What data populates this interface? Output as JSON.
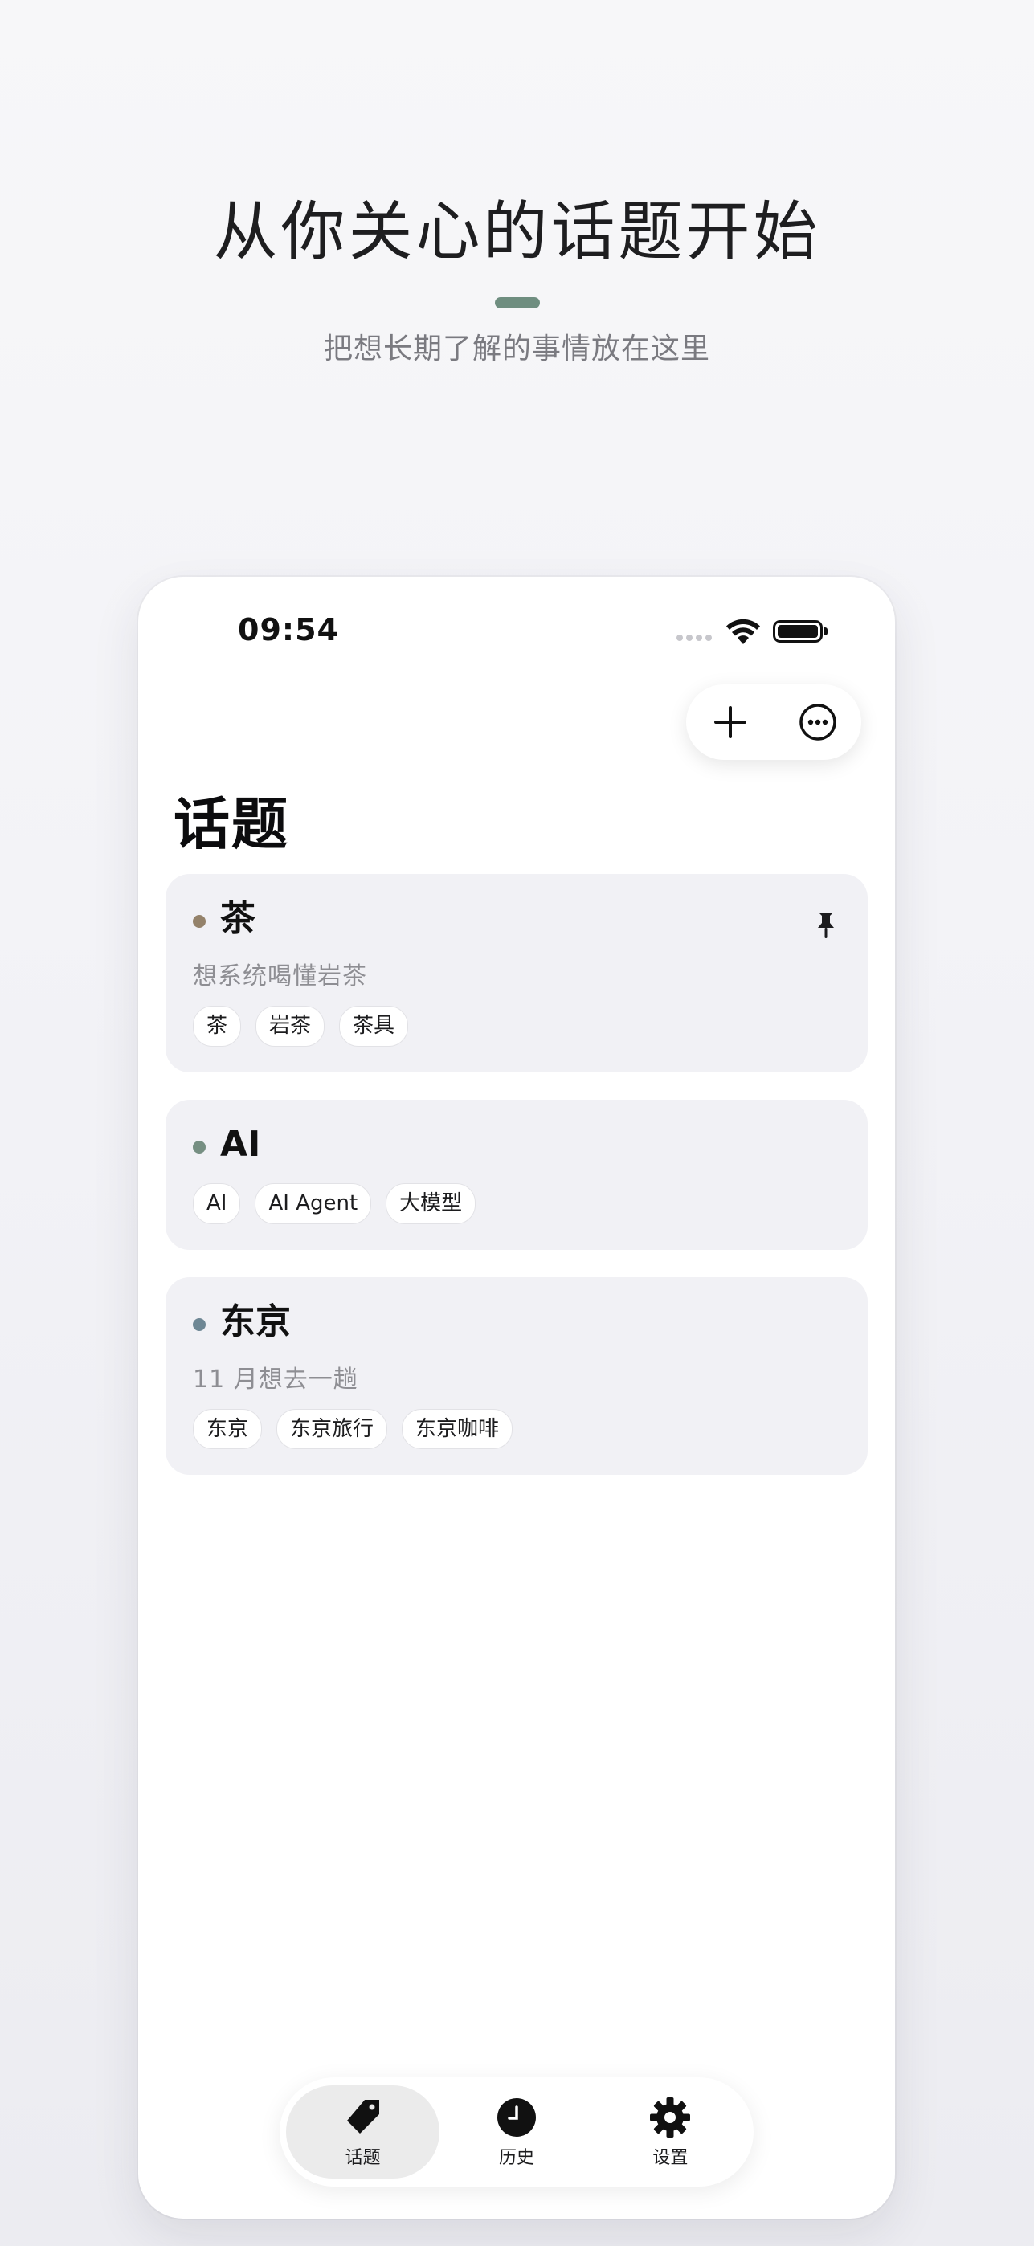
{
  "hero": {
    "title": "从你关心的话题开始",
    "subtitle": "把想长期了解的事情放在这里",
    "accent_color": "#6f8e80"
  },
  "status_bar": {
    "time": "09:54"
  },
  "toolbar": {
    "add_icon": "plus-icon",
    "more_icon": "ellipsis-circle-icon"
  },
  "page": {
    "title": "话题"
  },
  "topics": [
    {
      "name": "茶",
      "description": "想系统喝懂岩茶",
      "dot_color": "#94826a",
      "pinned": true,
      "tags": [
        "茶",
        "岩茶",
        "茶具"
      ]
    },
    {
      "name": "AI",
      "description": "",
      "dot_color": "#768f82",
      "pinned": false,
      "tags": [
        "AI",
        "AI Agent",
        "大模型"
      ]
    },
    {
      "name": "东京",
      "description": "11 月想去一趟",
      "dot_color": "#6e8794",
      "pinned": false,
      "tags": [
        "东京",
        "东京旅行",
        "东京咖啡"
      ]
    }
  ],
  "tabbar": {
    "tabs": [
      {
        "label": "话题",
        "icon": "tag-icon",
        "active": true
      },
      {
        "label": "历史",
        "icon": "clock-icon",
        "active": false
      },
      {
        "label": "设置",
        "icon": "gear-icon",
        "active": false
      }
    ]
  }
}
